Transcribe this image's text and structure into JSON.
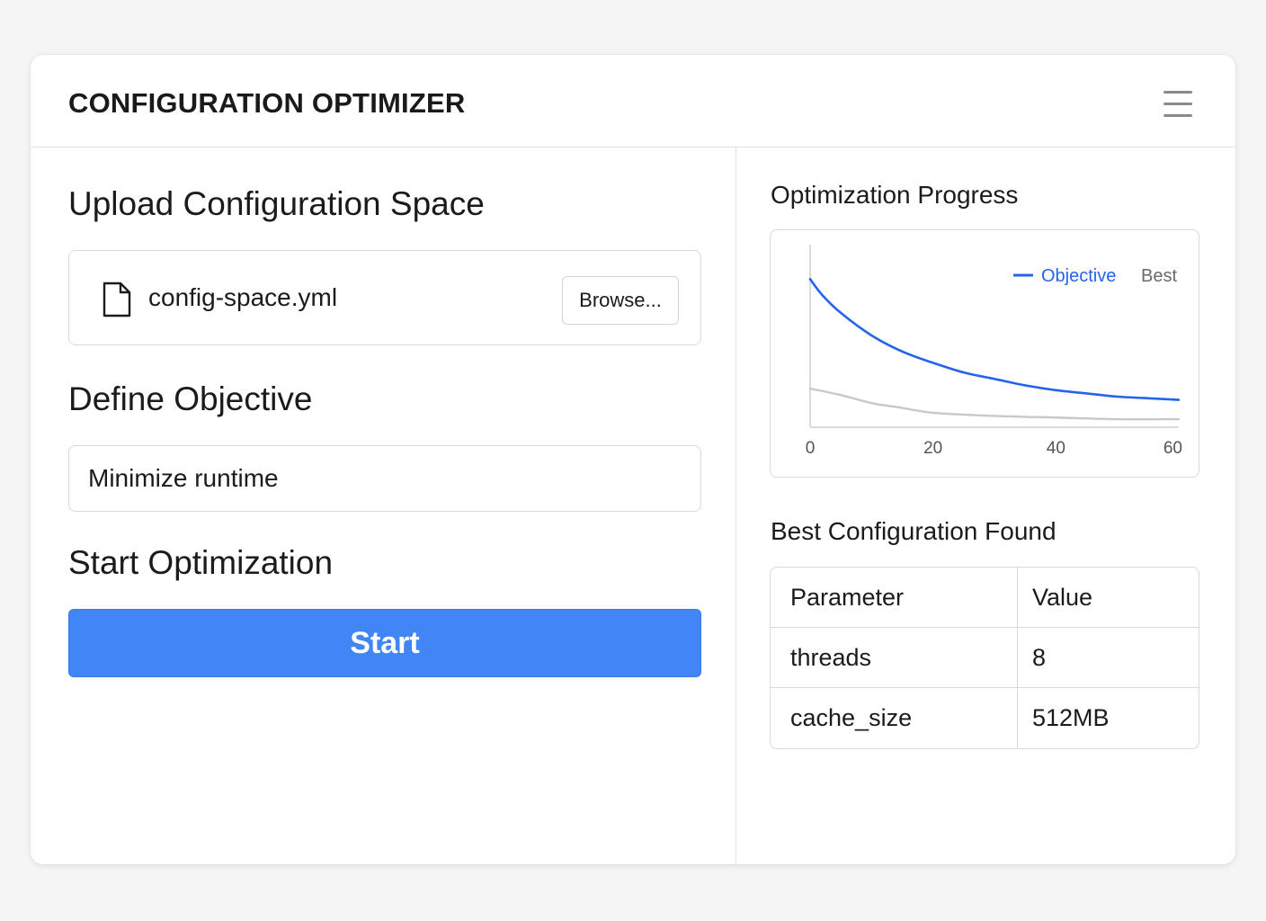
{
  "header": {
    "title": "CONFIGURATION OPTIMIZER",
    "menu_icon": "hamburger-menu-icon"
  },
  "upload": {
    "heading": "Upload Configuration Space",
    "file_icon": "file-icon",
    "file_name": "config-space.yml",
    "browse_label": "Browse..."
  },
  "objective": {
    "heading": "Define Objective",
    "value": "Minimize runtime"
  },
  "start": {
    "heading": "Start Optimization",
    "button_label": "Start"
  },
  "progress": {
    "heading": "Optimization Progress"
  },
  "best_config": {
    "heading": "Best Configuration Found",
    "columns": [
      "Parameter",
      "Value"
    ],
    "rows": [
      {
        "parameter": "threads",
        "value": "8"
      },
      {
        "parameter": "cache_size",
        "value": "512MB"
      }
    ]
  },
  "colors": {
    "accent": "#4285f4",
    "objective_line": "#2463eb",
    "best_line": "#c8c8c8"
  },
  "chart_data": {
    "type": "line",
    "title": "",
    "xlabel": "",
    "ylabel": "",
    "xlim": [
      0,
      60
    ],
    "ylim": [
      0,
      1
    ],
    "x_ticks": [
      "0",
      "20",
      "40",
      "60"
    ],
    "legend": {
      "placement": "top-right",
      "entries": [
        "Objective",
        "Best"
      ]
    },
    "grid": false,
    "series": [
      {
        "name": "Objective",
        "color": "#2463eb",
        "x": [
          0,
          2,
          5,
          10,
          15,
          20,
          25,
          30,
          35,
          40,
          45,
          50,
          55,
          60
        ],
        "y": [
          0.92,
          0.82,
          0.71,
          0.57,
          0.47,
          0.4,
          0.34,
          0.3,
          0.26,
          0.23,
          0.21,
          0.19,
          0.18,
          0.17
        ]
      },
      {
        "name": "Best",
        "color": "#c8c8c8",
        "x": [
          0,
          5,
          10,
          15,
          20,
          30,
          40,
          50,
          60
        ],
        "y": [
          0.24,
          0.2,
          0.15,
          0.12,
          0.09,
          0.07,
          0.06,
          0.05,
          0.05
        ]
      }
    ]
  }
}
